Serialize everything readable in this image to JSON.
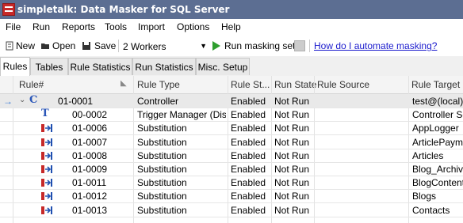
{
  "window": {
    "title": "simpletalk: Data Masker for SQL Server"
  },
  "menu": [
    "File",
    "Run",
    "Reports",
    "Tools",
    "Import",
    "Options",
    "Help"
  ],
  "toolbar": {
    "new_label": "New",
    "open_label": "Open",
    "save_label": "Save",
    "workers_value": "2 Workers",
    "run_label": "Run masking set",
    "link_label": "How do I automate masking?"
  },
  "tabs": [
    "Rules",
    "Tables",
    "Rule Statistics",
    "Run Statistics",
    "Misc. Setup"
  ],
  "columns": {
    "rule_num": "Rule#",
    "rule_type": "Rule Type",
    "rule_status": "Rule St...",
    "run_state": "Run State",
    "rule_source": "Rule Source",
    "rule_target": "Rule Target"
  },
  "rows": [
    {
      "num": "01-0001",
      "type": "Controller",
      "status": "Enabled",
      "run": "Not Run",
      "source": "",
      "target": "test@(local) v",
      "icon": "controller-icon"
    },
    {
      "num": "00-0002",
      "type": "Trigger Manager (Disa...",
      "status": "Enabled",
      "run": "Not Run",
      "source": "",
      "target": "Controller Sch",
      "icon": "trigger-icon"
    },
    {
      "num": "01-0006",
      "type": "Substitution",
      "status": "Enabled",
      "run": "Not Run",
      "source": "",
      "target": "AppLogger",
      "icon": "substitution-icon"
    },
    {
      "num": "01-0007",
      "type": "Substitution",
      "status": "Enabled",
      "run": "Not Run",
      "source": "",
      "target": "ArticlePaymen",
      "icon": "substitution-icon"
    },
    {
      "num": "01-0008",
      "type": "Substitution",
      "status": "Enabled",
      "run": "Not Run",
      "source": "",
      "target": "Articles",
      "icon": "substitution-icon"
    },
    {
      "num": "01-0009",
      "type": "Substitution",
      "status": "Enabled",
      "run": "Not Run",
      "source": "",
      "target": "Blog_Archive",
      "icon": "substitution-icon"
    },
    {
      "num": "01-0011",
      "type": "Substitution",
      "status": "Enabled",
      "run": "Not Run",
      "source": "",
      "target": "BlogContent",
      "icon": "substitution-icon"
    },
    {
      "num": "01-0012",
      "type": "Substitution",
      "status": "Enabled",
      "run": "Not Run",
      "source": "",
      "target": "Blogs",
      "icon": "substitution-icon"
    },
    {
      "num": "01-0013",
      "type": "Substitution",
      "status": "Enabled",
      "run": "Not Run",
      "source": "",
      "target": "Contacts",
      "icon": "substitution-icon"
    }
  ]
}
